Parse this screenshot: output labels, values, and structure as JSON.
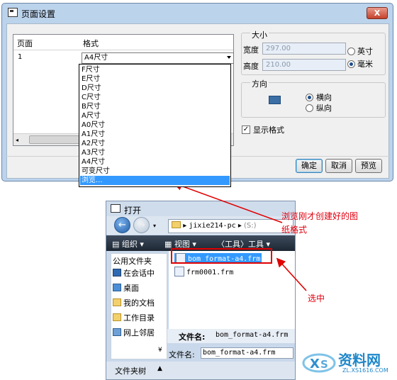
{
  "page_setup": {
    "title": "页面设置",
    "close_label": "X",
    "table": {
      "col_page": "页面",
      "col_format": "格式",
      "row_page": "1",
      "row_format": "A4尺寸"
    },
    "format_options": [
      "F尺寸",
      "E尺寸",
      "D尺寸",
      "C尺寸",
      "B尺寸",
      "A尺寸",
      "A0尺寸",
      "A1尺寸",
      "A2尺寸",
      "A3尺寸",
      "A4尺寸",
      "可变尺寸",
      "浏览..."
    ],
    "size": {
      "legend": "大小",
      "width_label": "宽度",
      "width_value": "297.00",
      "height_label": "高度",
      "height_value": "210.00",
      "unit_inch": "英寸",
      "unit_mm": "毫米",
      "selected_unit": "毫米"
    },
    "orientation": {
      "legend": "方向",
      "landscape": "横向",
      "portrait": "纵向",
      "selected": "横向"
    },
    "show_format": "显示格式",
    "show_format_checked": true,
    "buttons": {
      "ok": "确定",
      "cancel": "取消",
      "preview": "预览"
    }
  },
  "open_dialog": {
    "title": "打开",
    "path_segment_1": "jixie214-pc",
    "path_segment_2": "(S:)",
    "toolbar": {
      "organize": "组织",
      "views": "视图",
      "tools_prefix": "〈工具〉",
      "tools": "工具"
    },
    "sidebar": {
      "header": "公用文件夹",
      "items": [
        "在会话中",
        "桌面",
        "我的文档",
        "工作目录",
        "网上邻居"
      ],
      "footer": "文件夹树"
    },
    "files": [
      "bom_format-a4.frm",
      "frm0001.frm"
    ],
    "filename_label": "文件名:",
    "filename_value": "bom_format-a4.frm",
    "filename_label_2": "文件名:",
    "filename_value_2": "bom_format-a4.frm"
  },
  "annotations": {
    "note_1_line1": "浏览刚才创建好的图",
    "note_1_line2": "纸格式",
    "note_2": "选中"
  },
  "watermark": {
    "brand": "资料网",
    "domain": "ZL.XS1616.COM"
  },
  "colors": {
    "accent": "#3399ff",
    "annotation": "#e0000f",
    "titlebar": "#bcd3ec"
  }
}
